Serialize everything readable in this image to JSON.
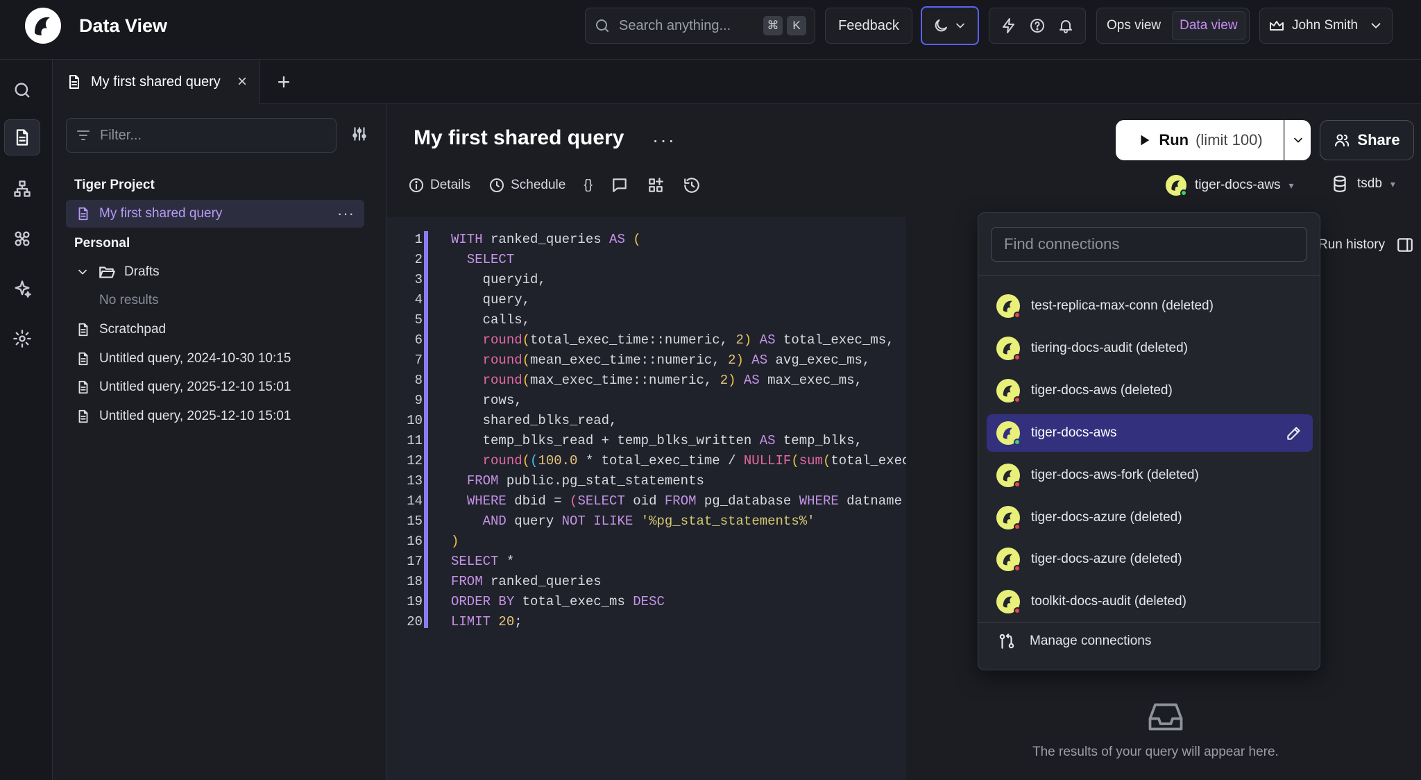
{
  "app": {
    "title": "Data View"
  },
  "header": {
    "search_placeholder": "Search anything...",
    "shortcut_cmd": "⌘",
    "shortcut_key": "K",
    "feedback_label": "Feedback",
    "ops_view_label": "Ops view",
    "data_view_label": "Data view",
    "user_name": "John Smith"
  },
  "tabs": [
    {
      "label": "My first shared query"
    }
  ],
  "sidebar": {
    "filter_placeholder": "Filter...",
    "section_project": "Tiger Project",
    "project_items": [
      {
        "label": "My first shared query"
      }
    ],
    "section_personal": "Personal",
    "folder_label": "Drafts",
    "folder_empty": "No results",
    "personal_items": [
      {
        "label": "Scratchpad"
      },
      {
        "label": "Untitled query, 2024-10-30 10:15"
      },
      {
        "label": "Untitled query, 2025-12-10 15:01"
      },
      {
        "label": "Untitled query, 2025-12-10 15:01"
      }
    ]
  },
  "query": {
    "title": "My first shared query",
    "run_label": "Run",
    "run_limit": "(limit 100)",
    "share_label": "Share",
    "toolbar": {
      "details": "Details",
      "schedule": "Schedule",
      "json": "{}"
    },
    "connection": "tiger-docs-aws",
    "database": "tsdb"
  },
  "editor": {
    "line_numbers": [
      "1",
      "2",
      "3",
      "4",
      "5",
      "6",
      "7",
      "8",
      "9",
      "10",
      "11",
      "12",
      "13",
      "14",
      "15",
      "16",
      "17",
      "18",
      "19",
      "20"
    ]
  },
  "results": {
    "run_history_label": "Run history",
    "empty_text": "The results of your query will appear here."
  },
  "connections_dropdown": {
    "search_placeholder": "Find connections",
    "items": [
      {
        "label": "test-replica-max-conn (deleted)",
        "status_color": "#e5484d"
      },
      {
        "label": "tiering-docs-audit (deleted)",
        "status_color": "#e5484d"
      },
      {
        "label": "tiger-docs-aws (deleted)",
        "status_color": "#e5484d"
      },
      {
        "label": "tiger-docs-aws",
        "status_color": "#3fcf6e",
        "selected": true
      },
      {
        "label": "tiger-docs-aws-fork (deleted)",
        "status_color": "#e5484d"
      },
      {
        "label": "tiger-docs-azure (deleted)",
        "status_color": "#e5484d"
      },
      {
        "label": "tiger-docs-azure (deleted)",
        "status_color": "#e5484d"
      },
      {
        "label": "toolkit-docs-audit (deleted)",
        "status_color": "#e5484d"
      }
    ],
    "manage_label": "Manage connections"
  },
  "colors": {
    "accent": "#8a7cf0",
    "selected_row": "#33307e",
    "theme_focus": "#5b63f5",
    "data_view": "#c98cf5"
  }
}
